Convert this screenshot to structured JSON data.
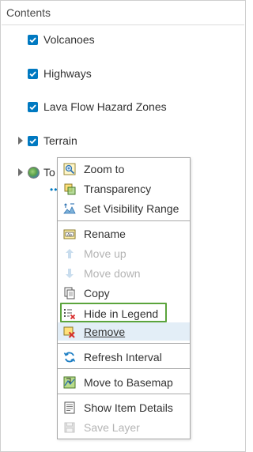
{
  "panel": {
    "title": "Contents"
  },
  "layers": [
    {
      "label": "Volcanoes",
      "checked": true
    },
    {
      "label": "Highways",
      "checked": true
    },
    {
      "label": "Lava Flow Hazard Zones",
      "checked": true
    },
    {
      "label": "Terrain",
      "checked": true,
      "expandable": true
    },
    {
      "label": "To",
      "icon": "globe-icon",
      "expandable": true
    }
  ],
  "context_menu": {
    "items": [
      {
        "label": "Zoom to",
        "icon": "zoom-to-icon",
        "enabled": true
      },
      {
        "label": "Transparency",
        "icon": "transparency-icon",
        "enabled": true
      },
      {
        "label": "Set Visibility Range",
        "icon": "visibility-range-icon",
        "enabled": true
      },
      {
        "label": "Rename",
        "icon": "rename-icon",
        "enabled": true
      },
      {
        "label": "Move up",
        "icon": "arrow-up-icon",
        "enabled": false
      },
      {
        "label": "Move down",
        "icon": "arrow-down-icon",
        "enabled": false
      },
      {
        "label": "Copy",
        "icon": "copy-icon",
        "enabled": true
      },
      {
        "label": "Hide in Legend",
        "icon": "hide-in-legend-icon",
        "enabled": true,
        "highlighted": true
      },
      {
        "label": "Remove",
        "icon": "remove-icon",
        "enabled": true,
        "hovered": true
      },
      {
        "label": "Refresh Interval",
        "icon": "refresh-icon",
        "enabled": true
      },
      {
        "label": "Move to Basemap",
        "icon": "move-to-basemap-icon",
        "enabled": true
      },
      {
        "label": "Show Item Details",
        "icon": "item-details-icon",
        "enabled": true
      },
      {
        "label": "Save Layer",
        "icon": "save-icon",
        "enabled": false
      }
    ]
  },
  "colors": {
    "checkbox": "#0079c1",
    "highlight_border": "#5ba43c",
    "hover_background": "#e3eef7",
    "disabled_text": "#b4b4b4"
  }
}
